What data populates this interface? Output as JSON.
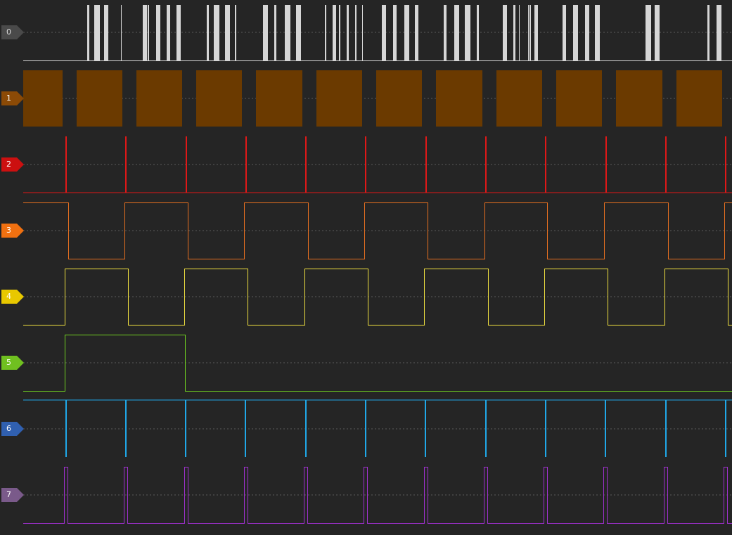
{
  "channels": [
    {
      "label": "0",
      "tag_color": "#4a4a4a",
      "trace_color": "#d6d6d6",
      "name_color": "#dcdcdc",
      "kind": "data-bursts"
    },
    {
      "label": "1",
      "tag_color": "#8b4a06",
      "trace_color": "#6b3a00",
      "name_color": "#ffffff",
      "kind": "dense-clock-blocks"
    },
    {
      "label": "2",
      "tag_color": "#cc1010",
      "trace_color": "#e01818",
      "name_color": "#ffffff",
      "kind": "pulses-up"
    },
    {
      "label": "3",
      "tag_color": "#f07010",
      "trace_color": "#e87020",
      "name_color": "#ffffff",
      "kind": "square"
    },
    {
      "label": "4",
      "tag_color": "#e8c800",
      "trace_color": "#f0e040",
      "name_color": "#ffffff",
      "kind": "square"
    },
    {
      "label": "5",
      "tag_color": "#70c020",
      "trace_color": "#70d020",
      "name_color": "#ffffff",
      "kind": "single-pulse"
    },
    {
      "label": "6",
      "tag_color": "#3060b0",
      "trace_color": "#20a8e8",
      "name_color": "#ffffff",
      "kind": "pulses-down"
    },
    {
      "label": "7",
      "tag_color": "#7a5a8a",
      "trace_color": "#a030d0",
      "name_color": "#ffffff",
      "kind": "short-pulses"
    }
  ]
}
